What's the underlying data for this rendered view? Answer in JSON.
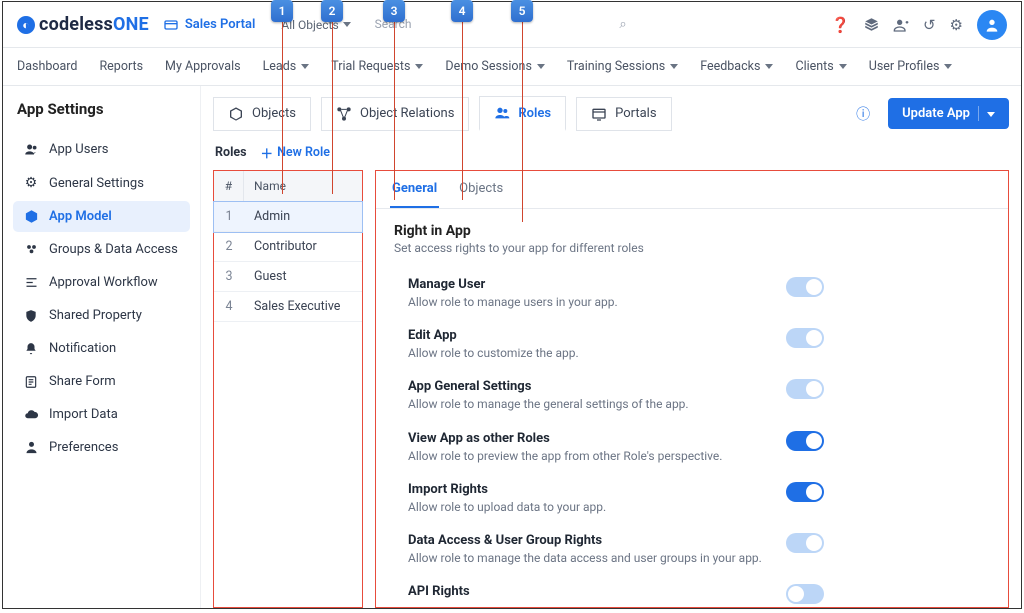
{
  "callouts": [
    "1",
    "2",
    "3",
    "4",
    "5"
  ],
  "header": {
    "logo_text": "codeless",
    "logo_suffix": "ONE",
    "portal_label": "Sales Portal",
    "object_filter": "All Objects",
    "search_placeholder": "Search"
  },
  "nav": {
    "items": [
      "Dashboard",
      "Reports",
      "My Approvals",
      "Leads",
      "Trial Requests",
      "Demo Sessions",
      "Training Sessions",
      "Feedbacks",
      "Clients",
      "User Profiles"
    ],
    "with_caret": [
      false,
      false,
      false,
      true,
      true,
      true,
      true,
      true,
      true,
      true
    ]
  },
  "sidebar": {
    "title": "App Settings",
    "items": [
      {
        "icon": "users",
        "label": "App Users"
      },
      {
        "icon": "gear",
        "label": "General Settings"
      },
      {
        "icon": "cube",
        "label": "App Model"
      },
      {
        "icon": "group",
        "label": "Groups & Data Access"
      },
      {
        "icon": "flow",
        "label": "Approval Workflow"
      },
      {
        "icon": "shield",
        "label": "Shared Property"
      },
      {
        "icon": "bell",
        "label": "Notification"
      },
      {
        "icon": "form",
        "label": "Share Form"
      },
      {
        "icon": "cloud",
        "label": "Import Data"
      },
      {
        "icon": "pref",
        "label": "Preferences"
      }
    ],
    "active_index": 2
  },
  "model_tabs": {
    "items": [
      "Objects",
      "Object Relations",
      "Roles",
      "Portals"
    ],
    "active_index": 2,
    "update_label": "Update App"
  },
  "roles": {
    "heading": "Roles",
    "new_role_label": "New Role",
    "columns": [
      "#",
      "Name"
    ],
    "rows": [
      {
        "n": "1",
        "name": "Admin",
        "selected": true
      },
      {
        "n": "2",
        "name": "Contributor",
        "selected": false
      },
      {
        "n": "3",
        "name": "Guest",
        "selected": false
      },
      {
        "n": "4",
        "name": "Sales Executive",
        "selected": false
      }
    ]
  },
  "inner_tabs": {
    "items": [
      "General",
      "Objects"
    ],
    "active_index": 0
  },
  "rights": {
    "title": "Right in App",
    "subtitle": "Set access rights to your app for different roles",
    "perms": [
      {
        "title": "Manage User",
        "desc": "Allow role to manage users in your app.",
        "state": "on-light"
      },
      {
        "title": "Edit App",
        "desc": "Allow role to customize the app.",
        "state": "on-light"
      },
      {
        "title": "App General Settings",
        "desc": "Allow role to manage the general settings of the app.",
        "state": "on-light"
      },
      {
        "title": "View App as other Roles",
        "desc": "Allow role to preview the app from other Role's perspective.",
        "state": "on"
      },
      {
        "title": "Import Rights",
        "desc": "Allow role to upload data to your app.",
        "state": "on"
      },
      {
        "title": "Data Access & User Group Rights",
        "desc": "Allow role to manage the data access and user groups in your app.",
        "state": "on-light"
      },
      {
        "title": "API Rights",
        "desc": "",
        "state": "off-light"
      }
    ]
  }
}
